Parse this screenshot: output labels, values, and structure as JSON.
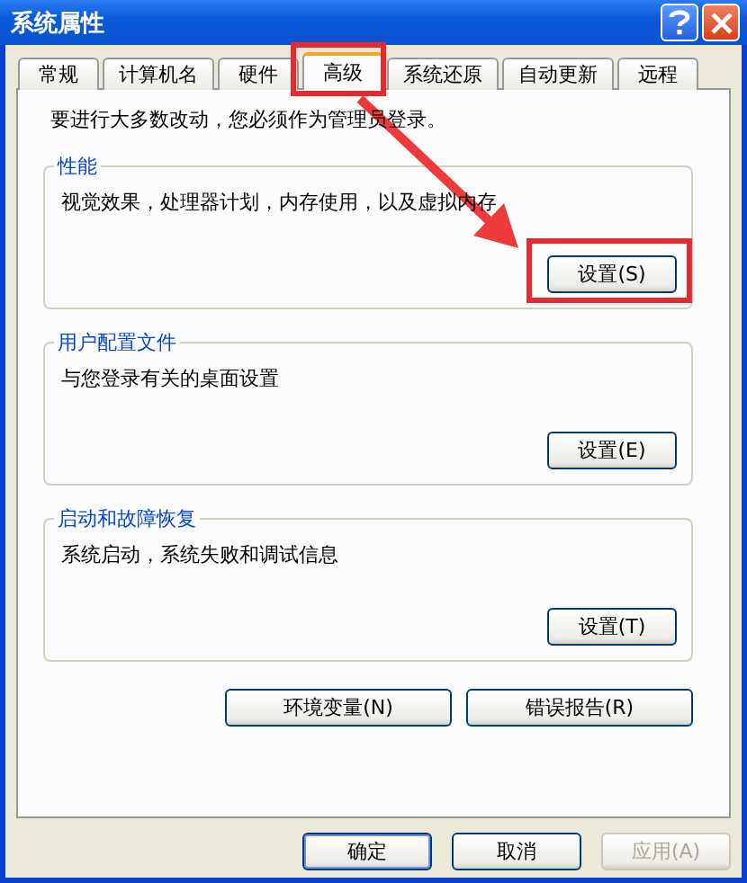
{
  "window": {
    "title": "系统属性"
  },
  "tabs": [
    {
      "label": "常规",
      "selected": false
    },
    {
      "label": "计算机名",
      "selected": false
    },
    {
      "label": "硬件",
      "selected": false
    },
    {
      "label": "高级",
      "selected": true
    },
    {
      "label": "系统还原",
      "selected": false
    },
    {
      "label": "自动更新",
      "selected": false
    },
    {
      "label": "远程",
      "selected": false
    }
  ],
  "notice": "要进行大多数改动，您必须作为管理员登录。",
  "groups": [
    {
      "title": "性能",
      "description": "视觉效果，处理器计划，内存使用，以及虚拟内存",
      "button": "设置(S)"
    },
    {
      "title": "用户配置文件",
      "description": "与您登录有关的桌面设置",
      "button": "设置(E)"
    },
    {
      "title": "启动和故障恢复",
      "description": "系统启动，系统失败和调试信息",
      "button": "设置(T)"
    }
  ],
  "extra_buttons": [
    "环境变量(N)",
    "错误报告(R)"
  ],
  "dialog_buttons": [
    {
      "label": "确定",
      "disabled": false
    },
    {
      "label": "取消",
      "disabled": false
    },
    {
      "label": "应用(A)",
      "disabled": true
    }
  ]
}
